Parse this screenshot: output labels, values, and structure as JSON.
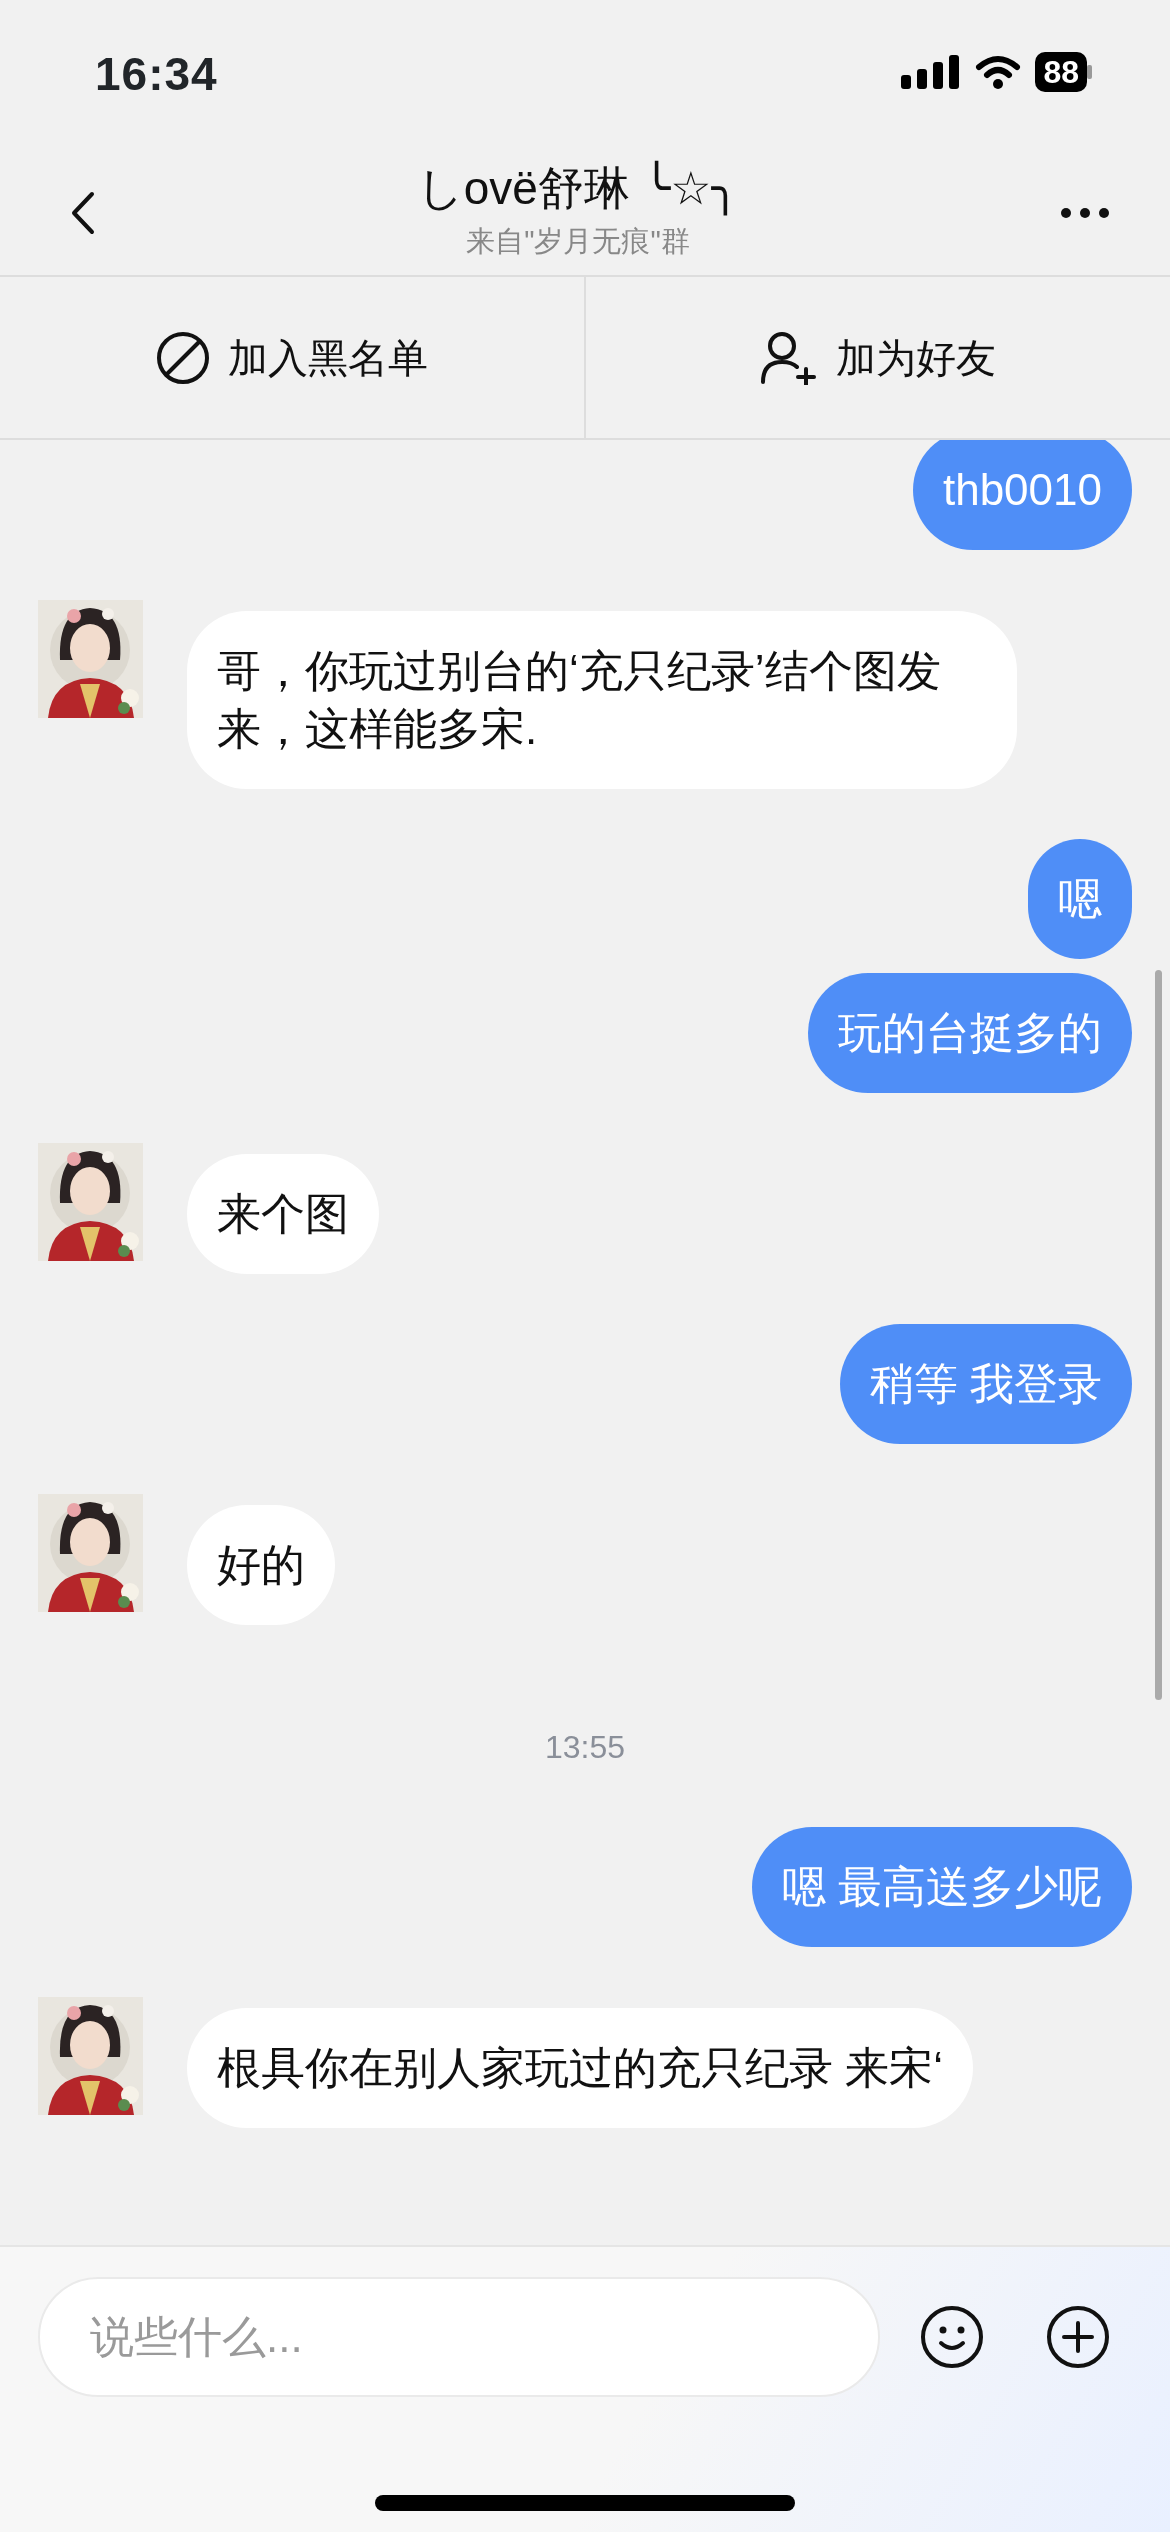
{
  "status_bar": {
    "time": "16:34",
    "battery": "88"
  },
  "header": {
    "title": "しovë舒琳 ╰☆╮",
    "subtitle": "来自\"岁月无痕\"群"
  },
  "actions": [
    {
      "kind": "block",
      "label": "加入黑名单"
    },
    {
      "kind": "add_friend",
      "label": "加为好友"
    }
  ],
  "messages": [
    {
      "kind": "out",
      "text": "thb0010"
    },
    {
      "kind": "in",
      "text": "哥，你玩过别台的‘充只纪录’结个图发来，这样能多宋."
    },
    {
      "kind": "out",
      "text": "嗯"
    },
    {
      "kind": "out",
      "text": "玩的台挺多的"
    },
    {
      "kind": "in",
      "text": "来个图"
    },
    {
      "kind": "out",
      "text": "稍等 我登录"
    },
    {
      "kind": "in",
      "text": "好的"
    },
    {
      "kind": "time",
      "text": "13:55"
    },
    {
      "kind": "out",
      "text": "嗯 最高送多少呢"
    },
    {
      "kind": "in",
      "text": "根具你在别人家玩过的充只纪录 来宋‘"
    }
  ],
  "input": {
    "placeholder": "说些什么..."
  }
}
